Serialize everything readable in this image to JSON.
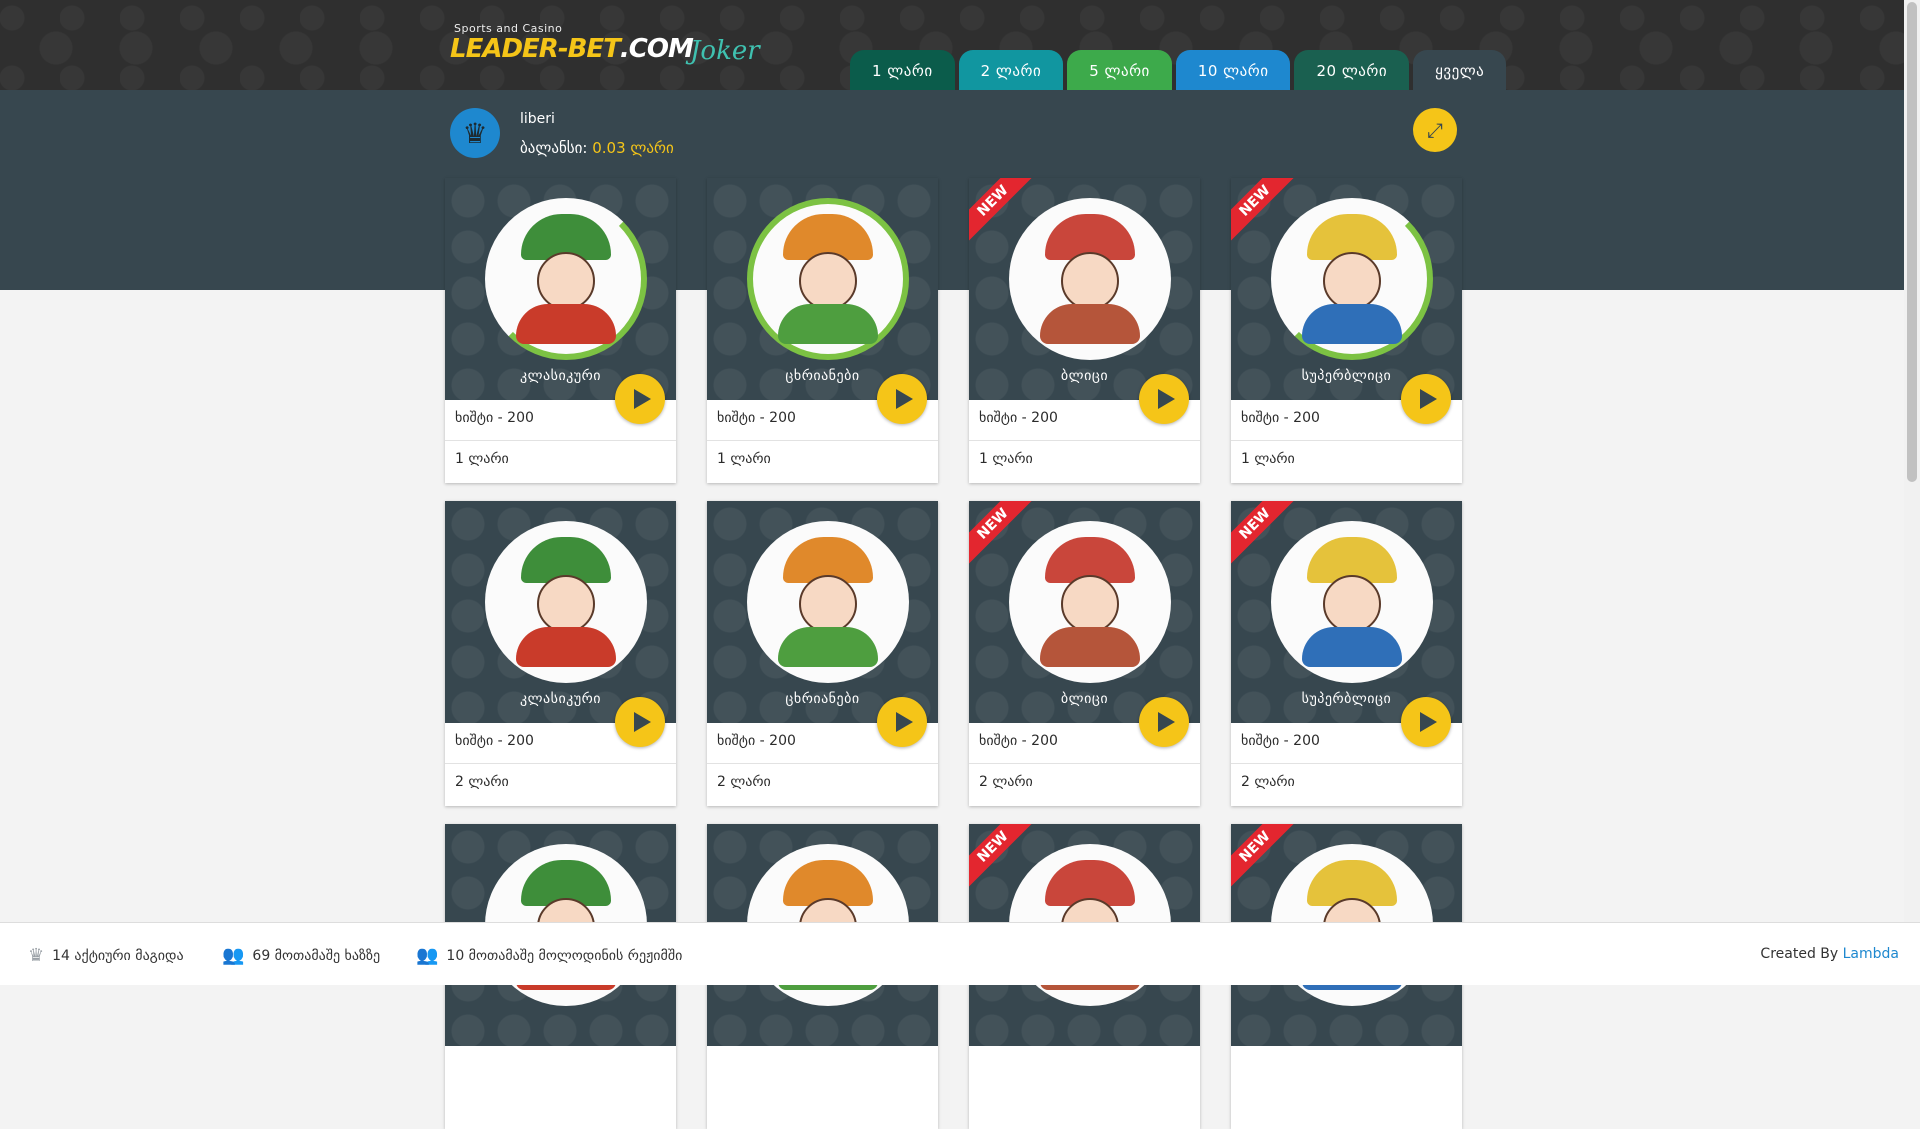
{
  "header": {
    "tagline": "Sports and Casino",
    "brand_main": "LEADER-BET",
    "brand_suffix": ".COM",
    "joker": "Joker",
    "tabs": [
      "1 ლარი",
      "2 ლარი",
      "5 ლარი",
      "10 ლარი",
      "20 ლარი",
      "ყველა"
    ]
  },
  "user": {
    "name": "liberi",
    "balance_label": "ბალანსი:",
    "balance_value": "0.03 ლარი"
  },
  "cards": [
    {
      "name": "კლასიკური",
      "capacity": "ხიშტი - 200",
      "price": "1 ლარი"
    },
    {
      "name": "ცხრიანები",
      "capacity": "ხიშტი - 200",
      "price": "1 ლარი"
    },
    {
      "name": "ბლიცი",
      "capacity": "ხიშტი - 200",
      "price": "1 ლარი",
      "badge": "NEW"
    },
    {
      "name": "სუპერბლიცი",
      "capacity": "ხიშტი - 200",
      "price": "1 ლარი",
      "badge": "NEW"
    },
    {
      "name": "კლასიკური",
      "capacity": "ხიშტი - 200",
      "price": "2 ლარი"
    },
    {
      "name": "ცხრიანები",
      "capacity": "ხიშტი - 200",
      "price": "2 ლარი"
    },
    {
      "name": "ბლიცი",
      "capacity": "ხიშტი - 200",
      "price": "2 ლარი",
      "badge": "NEW"
    },
    {
      "name": "სუპერბლიცი",
      "capacity": "ხიშტი - 200",
      "price": "2 ლარი",
      "badge": "NEW"
    },
    {
      "badge_row": ""
    },
    {},
    {
      "badge": "NEW"
    },
    {
      "badge": "NEW"
    }
  ],
  "footer": {
    "active_tables": "14 აქტიური მაგიდა",
    "players_online": "69 მოთამაშე ხაზზე",
    "waiting": "10 მოთამაშე მოლოდინის რეჟიმში",
    "credit_prefix": "Created By",
    "credit_link": "Lambda"
  }
}
